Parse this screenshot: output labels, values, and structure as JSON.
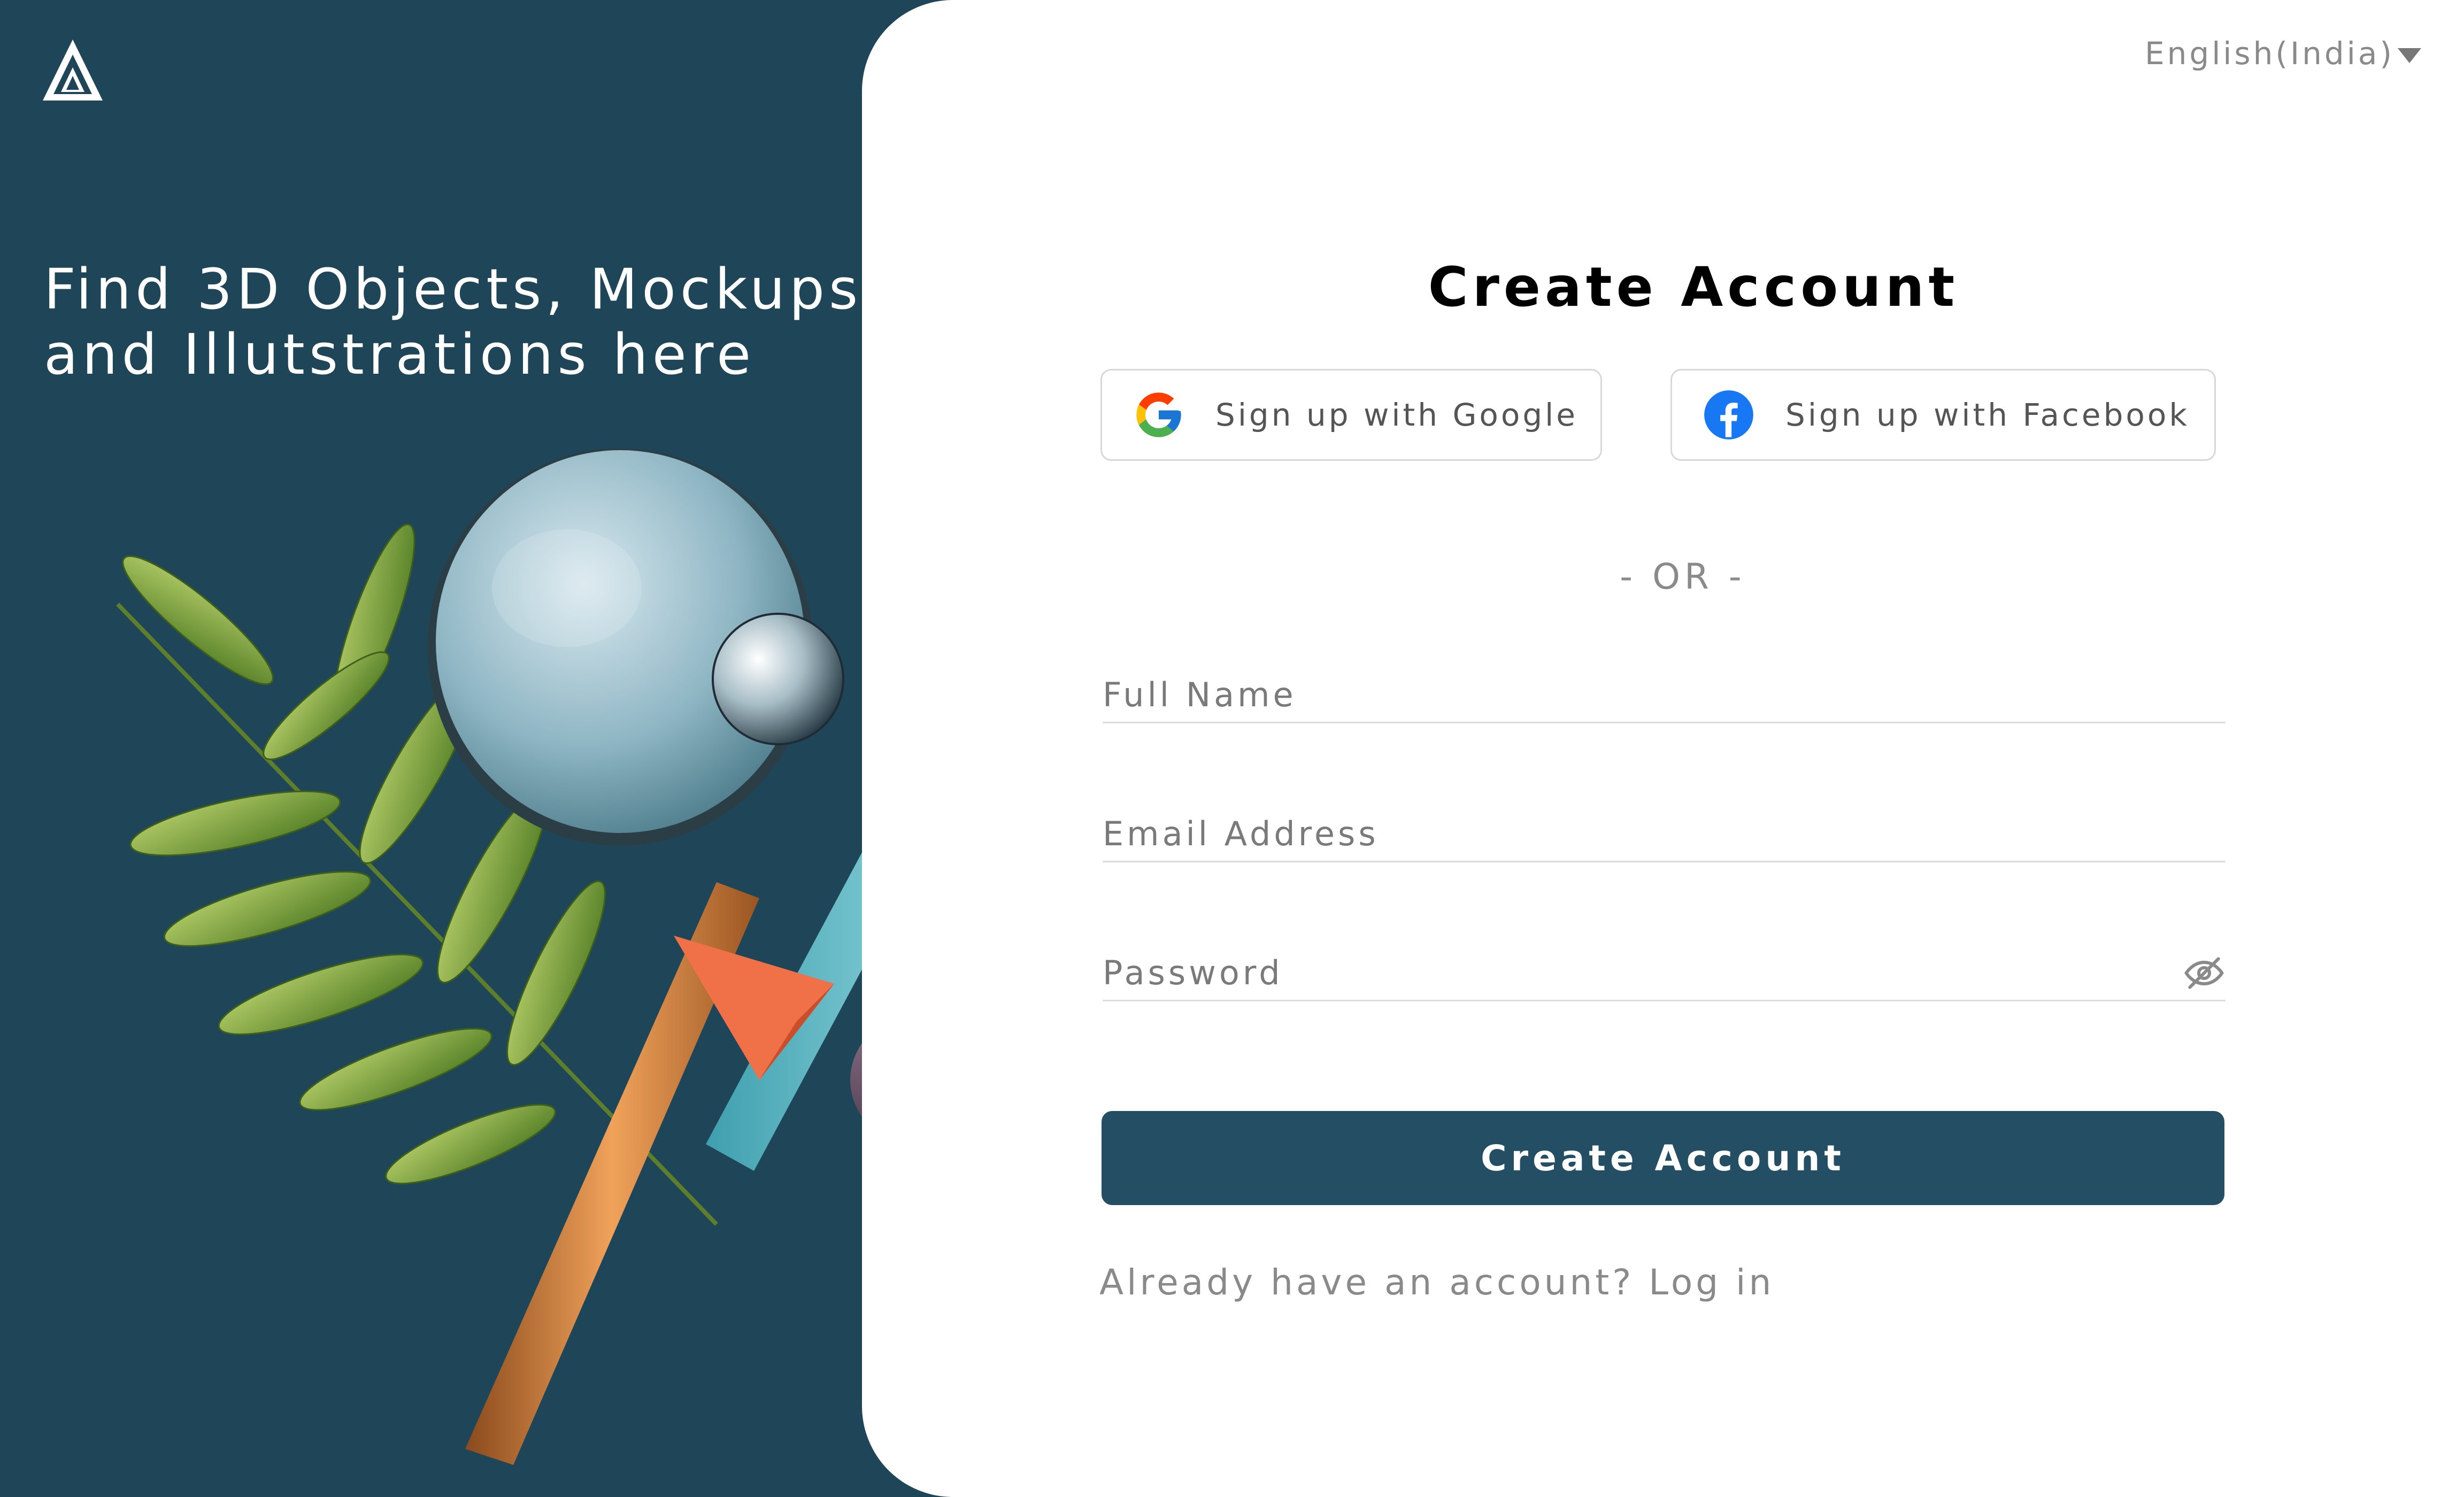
{
  "brand": {
    "logo_icon": "triangle-logo-icon",
    "tagline_line1": "Find 3D Objects, Mockups",
    "tagline_line2": "and Illutstrations here"
  },
  "language": {
    "selected": "English(India)",
    "icon": "caret-down-icon"
  },
  "form": {
    "title": "Create Account",
    "google_label": "Sign up with Google",
    "facebook_label": "Sign up with Facebook",
    "divider": "- OR -",
    "full_name_placeholder": "Full Name",
    "email_placeholder": "Email Address",
    "password_placeholder": "Password",
    "password_toggle_icon": "eye-off-icon",
    "submit_label": "Create Account",
    "login_prompt": "Already have an account?",
    "login_link": "Log in"
  },
  "colors": {
    "panel": "#1f4658",
    "button": "#234e63",
    "facebook": "#1877F2"
  }
}
